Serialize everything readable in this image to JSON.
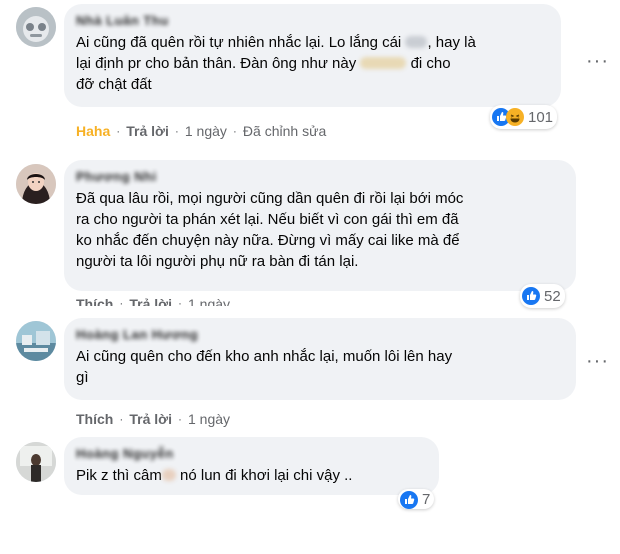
{
  "comments": [
    {
      "author": "Nhà Luân Thu",
      "text_lines": [
        [
          "Ai cũng đã quên rồi tự nhiên nhắc lại. Lo lắng cái ",
          "",
          ", hay là"
        ],
        [
          "lại định pr cho bản thân. Đàn ông như này ",
          "",
          "đi cho"
        ],
        [
          "đỡ chật đất",
          "",
          ""
        ]
      ],
      "reaction_icons": [
        "like-icon",
        "haha-icon"
      ],
      "reaction_count": "101",
      "actions": {
        "react": "Haha",
        "reply": "Trả lời",
        "time": "1 ngày",
        "edited": "Đã chỉnh sửa"
      },
      "react_color": "#f7b125"
    },
    {
      "author": "Phương Nhi",
      "text_lines": [
        "Đã qua lâu rồi, mọi người cũng dần quên đi rồi lại bới móc",
        "ra cho người ta phán xét lại. Nếu biết vì con gái thì em đã",
        "ko nhắc đến chuyện này nữa. Đừng vì mấy cai like mà để",
        "người ta lôi người phụ nữ ra bàn đi tán lại."
      ],
      "reaction_icons": [
        "like-icon"
      ],
      "reaction_count": "52",
      "actions": {
        "react": "Thích",
        "reply": "Trả lời",
        "time": "1 ngày"
      }
    },
    {
      "author": "Hoàng Lan Hương",
      "text_lines": [
        "Ai cũng quên cho đến kho anh nhắc lại, muốn lôi lên hay",
        "gì"
      ],
      "actions": {
        "react": "Thích",
        "reply": "Trả lời",
        "time": "1 ngày"
      }
    },
    {
      "author": "Hoàng Nguyễn",
      "text_lines": [
        [
          "Pik z thì câm",
          "",
          " nó lun đi khơi lại chi vậy .."
        ]
      ],
      "reaction_icons": [
        "like-icon"
      ],
      "reaction_count": "7"
    }
  ],
  "colors": {
    "bubble": "#f0f2f5",
    "meta": "#65676b",
    "like": "#1877f2",
    "haha": "#f7b125"
  }
}
